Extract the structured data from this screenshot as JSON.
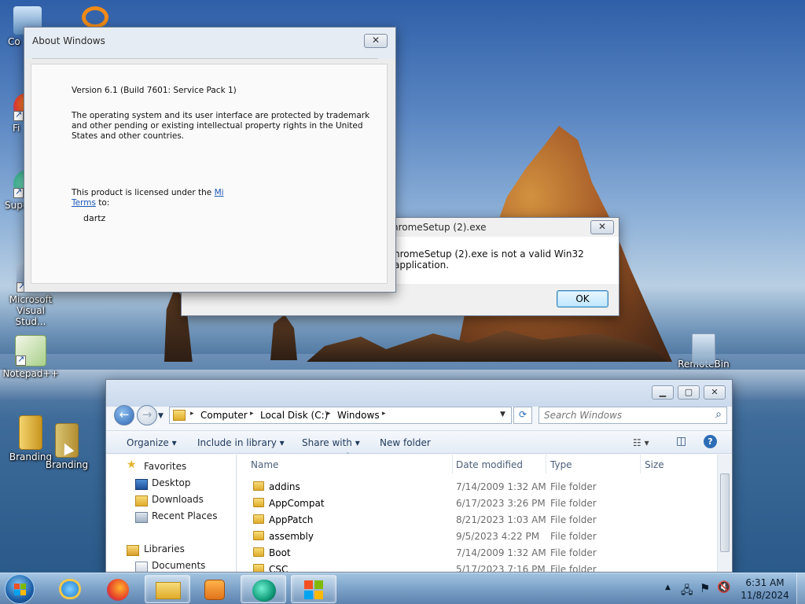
{
  "desktop": {
    "icons": [
      {
        "label": "Co"
      },
      {
        "label": "Fi"
      },
      {
        "label": "Supe"
      },
      {
        "label": "Microsoft Visual Stud..."
      },
      {
        "label": "Notepad++"
      },
      {
        "label": "Branding"
      },
      {
        "label": "Branding"
      },
      {
        "label": "RemoteBin"
      }
    ]
  },
  "about_window": {
    "title": "About Windows",
    "close_glyph": "✕",
    "version": "Version 6.1 (Build 7601: Service Pack 1)",
    "trademark_line1": "The  operating system and its user interface are protected by trademark",
    "trademark_line2": "and other pending or existing intellectual property rights in the United",
    "trademark_line3": "States and other countries.",
    "license_prefix": "This product is licensed under the ",
    "license_link1": "Mi",
    "license_link2": "Terms",
    "license_suffix": " to:",
    "licensee": "dartz"
  },
  "error_dialog": {
    "title": "hromeSetup (2).exe",
    "close_glyph": "✕",
    "message": "hromeSetup (2).exe is not a valid Win32 application.",
    "ok_label": "OK"
  },
  "explorer": {
    "caption": {
      "minimize": "▁",
      "maximize": "▢",
      "close": "✕"
    },
    "back_glyph": "←",
    "forward_glyph": "→",
    "breadcrumb": [
      "Computer",
      "Local Disk (C:)",
      "Windows"
    ],
    "breadcrumb_sep": "▸",
    "refresh_glyph": "⟳",
    "search_placeholder": "Search Windows",
    "search_icon": "⌕",
    "toolbar": {
      "organize": "Organize ▾",
      "include_in_library": "Include in library ▾",
      "share_with": "Share with ▾",
      "new_folder": "New folder",
      "view_glyph": "☷ ▾",
      "preview_glyph": "◫",
      "help_glyph": "?"
    },
    "nav": {
      "favorites": "Favorites",
      "desktop": "Desktop",
      "downloads": "Downloads",
      "recent_places": "Recent Places",
      "libraries": "Libraries",
      "documents": "Documents"
    },
    "columns": {
      "name": "Name",
      "date_modified": "Date modified",
      "type": "Type",
      "size": "Size"
    },
    "rows": [
      {
        "name": "addins",
        "date": "7/14/2009 1:32 AM",
        "type": "File folder"
      },
      {
        "name": "AppCompat",
        "date": "6/17/2023 3:26 PM",
        "type": "File folder"
      },
      {
        "name": "AppPatch",
        "date": "8/21/2023 1:03 AM",
        "type": "File folder"
      },
      {
        "name": "assembly",
        "date": "9/5/2023 4:22 PM",
        "type": "File folder"
      },
      {
        "name": "Boot",
        "date": "7/14/2009 1:32 AM",
        "type": "File folder"
      },
      {
        "name": "CSC",
        "date": "5/17/2023 7:16 PM",
        "type": "File folder"
      }
    ]
  },
  "taskbar": {
    "tray_glyphs": {
      "show_hidden": "▲",
      "network": "🖧",
      "flag": "⚑",
      "volume": "🔇"
    },
    "time": "6:31 AM",
    "date": "11/8/2024"
  },
  "colors": {
    "accent": "#1a56b8",
    "taskbar": "#7aa0c8",
    "folder": "#e8b93a"
  }
}
